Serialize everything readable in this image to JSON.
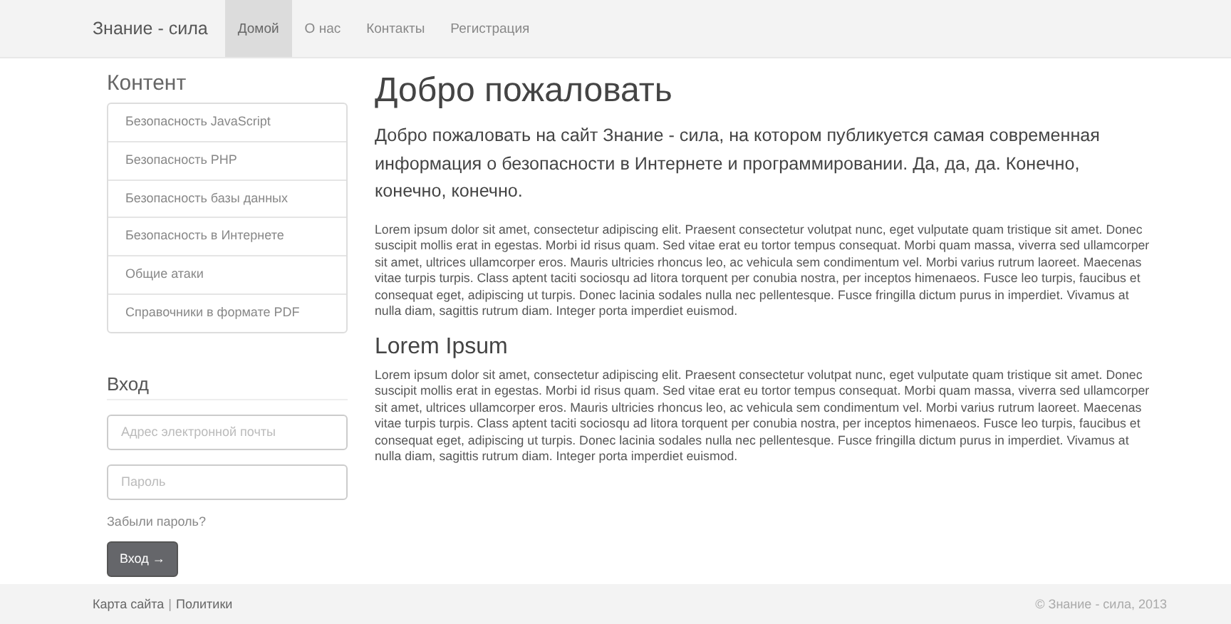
{
  "navbar": {
    "brand": "Знание - сила",
    "items": [
      {
        "label": "Домой",
        "selected": true
      },
      {
        "label": "О нас",
        "selected": false
      },
      {
        "label": "Контакты",
        "selected": false
      },
      {
        "label": "Регистрация",
        "selected": false
      }
    ]
  },
  "sidebar": {
    "title": "Контент",
    "items": [
      "Безопасность JavaScript",
      "Безопасность PHP",
      "Безопасность базы данных",
      "Безопасность в Интернете",
      "Общие атаки",
      "Справочники в формате PDF"
    ]
  },
  "login": {
    "title": "Вход",
    "email": {
      "placeholder": "Адрес электронной почты"
    },
    "password": {
      "placeholder": "Пароль"
    },
    "forgot": "Забыли пароль?",
    "button": "Вход →"
  },
  "main": {
    "title": "Добро пожаловать",
    "lead": "Добро пожаловать на сайт Знание - сила, на котором публикуется самая современная информация о безопасности в Интернете и программировании. Да, да, да. Конечно, конечно, конечно.",
    "sections": [
      {
        "text": "Lorem ipsum dolor sit amet, consectetur adipiscing elit. Praesent consectetur volutpat nunc, eget vulputate quam tristique sit amet. Donec suscipit mollis erat in egestas. Morbi id risus quam. Sed vitae erat eu tortor tempus consequat. Morbi quam massa, viverra sed ullamcorper sit amet, ultrices ullamcorper eros. Mauris ultricies rhoncus leo, ac vehicula sem condimentum vel. Morbi varius rutrum laoreet. Maecenas vitae turpis turpis. Class aptent taciti sociosqu ad litora torquent per conubia nostra, per inceptos himenaeos. Fusce leo turpis, faucibus et consequat eget, adipiscing ut turpis. Donec lacinia sodales nulla nec pellentesque. Fusce fringilla dictum purus in imperdiet. Vivamus at nulla diam, sagittis rutrum diam. Integer porta imperdiet euismod."
      },
      {
        "heading": "Lorem Ipsum",
        "text": "Lorem ipsum dolor sit amet, consectetur adipiscing elit. Praesent consectetur volutpat nunc, eget vulputate quam tristique sit amet. Donec suscipit mollis erat in egestas. Morbi id risus quam. Sed vitae erat eu tortor tempus consequat. Morbi quam massa, viverra sed ullamcorper sit amet, ultrices ullamcorper eros. Mauris ultricies rhoncus leo, ac vehicula sem condimentum vel. Morbi varius rutrum laoreet. Maecenas vitae turpis turpis. Class aptent taciti sociosqu ad litora torquent per conubia nostra, per inceptos himenaeos. Fusce leo turpis, faucibus et consequat eget, adipiscing ut turpis. Donec lacinia sodales nulla nec pellentesque. Fusce fringilla dictum purus in imperdiet. Vivamus at nulla diam, sagittis rutrum diam. Integer porta imperdiet euismod."
      }
    ]
  },
  "footer": {
    "links": [
      "Карта сайта",
      "Политики"
    ],
    "separator": "|",
    "copyright": "© Знание - сила, 2013"
  }
}
